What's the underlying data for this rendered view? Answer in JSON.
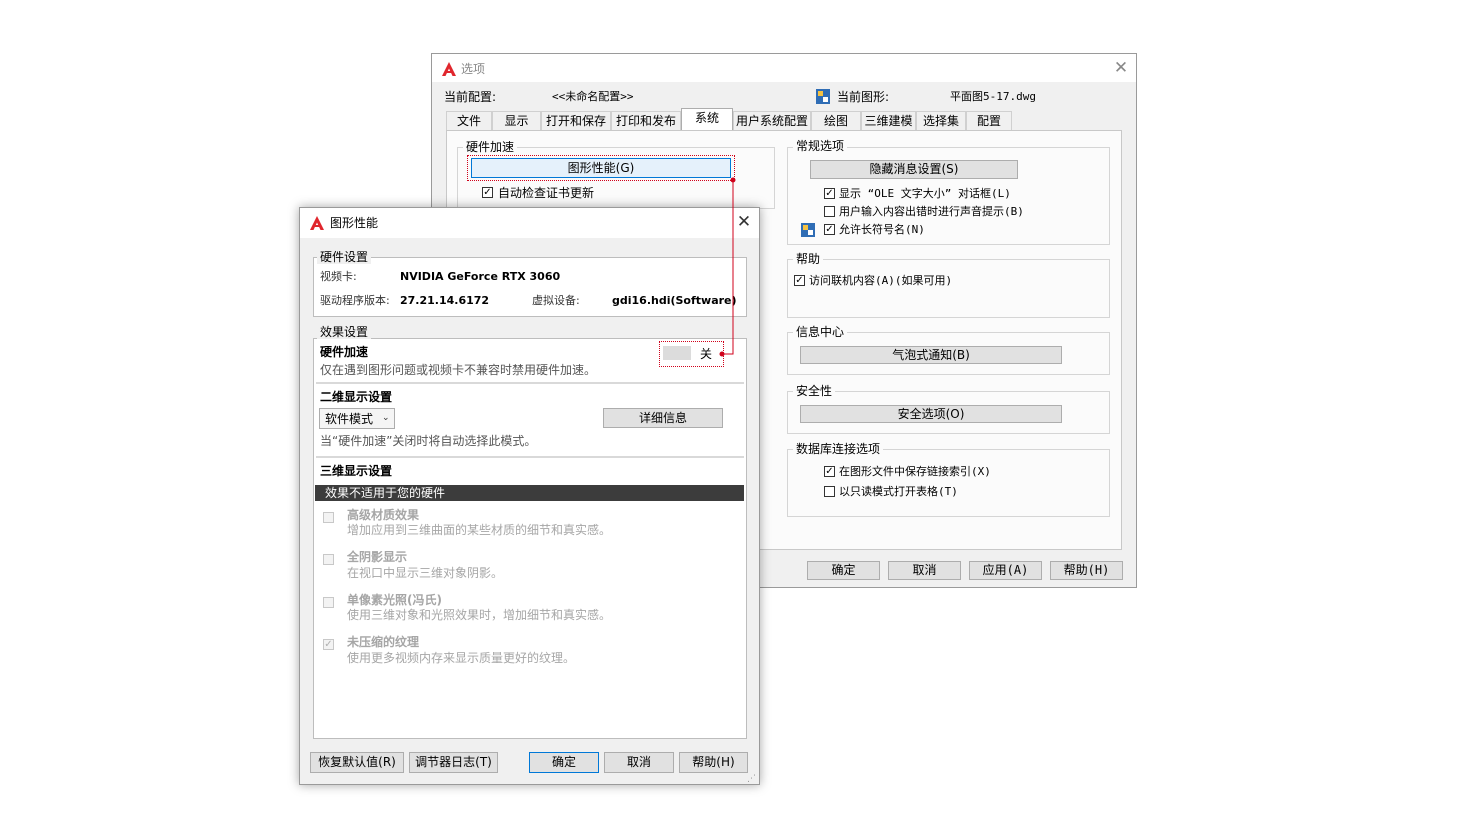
{
  "options": {
    "title": "选项",
    "current_profile_label": "当前配置:",
    "current_profile_value": "<<未命名配置>>",
    "current_drawing_label": "当前图形:",
    "current_drawing_value": "平面图5-17.dwg",
    "tabs": [
      "文件",
      "显示",
      "打开和保存",
      "打印和发布",
      "系统",
      "用户系统配置",
      "绘图",
      "三维建模",
      "选择集",
      "配置"
    ],
    "hardware_accel": {
      "title": "硬件加速",
      "graphics_perf_button": "图形性能(G)",
      "auto_check_cert": "自动检查证书更新"
    },
    "general": {
      "title": "常规选项",
      "hide_messages_button": "隐藏消息设置(S)",
      "show_ole": "显示 “OLE 文字大小” 对话框(L)",
      "beep": "用户输入内容出错时进行声音提示(B)",
      "long_names": "允许长符号名(N)"
    },
    "help": {
      "title": "帮助",
      "online_content": "访问联机内容(A)(如果可用)"
    },
    "info_center": {
      "title": "信息中心",
      "balloon_button": "气泡式通知(B)"
    },
    "security": {
      "title": "安全性",
      "security_button": "安全选项(O)"
    },
    "db": {
      "title": "数据库连接选项",
      "store_links": "在图形文件中保存链接索引(X)",
      "readonly_tables": "以只读模式打开表格(T)"
    },
    "buttons": {
      "ok": "确定",
      "cancel": "取消",
      "apply": "应用(A)",
      "help": "帮助(H)"
    }
  },
  "perf": {
    "title": "图形性能",
    "hardware": {
      "title": "硬件设置",
      "video_label": "视频卡:",
      "video_value": "NVIDIA GeForce RTX 3060",
      "driver_label": "驱动程序版本:",
      "driver_value": "27.21.14.6172",
      "virtual_label": "虚拟设备:",
      "virtual_value": "gdi16.hdi(Software)"
    },
    "effects": {
      "title": "效果设置",
      "hw_accel_title": "硬件加速",
      "hw_accel_desc": "仅在遇到图形问题或视频卡不兼容时禁用硬件加速。",
      "toggle_state": "关"
    },
    "display2d": {
      "title": "二维显示设置",
      "mode": "软件模式",
      "details_button": "详细信息",
      "note": "当“硬件加速”关闭时将自动选择此模式。"
    },
    "display3d": {
      "title": "三维显示设置",
      "banner": "效果不适用于您的硬件",
      "items": [
        {
          "name": "高级材质效果",
          "desc": "增加应用到三维曲面的某些材质的细节和真实感。",
          "checked": false
        },
        {
          "name": "全阴影显示",
          "desc": "在视口中显示三维对象阴影。",
          "checked": false
        },
        {
          "name": "单像素光照(冯氏)",
          "desc": "使用三维对象和光照效果时，增加细节和真实感。",
          "checked": false
        },
        {
          "name": "未压缩的纹理",
          "desc": "使用更多视频内存来显示质量更好的纹理。",
          "checked": true
        }
      ]
    },
    "buttons": {
      "restore": "恢复默认值(R)",
      "log": "调节器日志(T)",
      "ok": "确定",
      "cancel": "取消",
      "help": "帮助(H)"
    }
  },
  "colors": {
    "accent_red": "#d0021b",
    "banner_bg": "#3c3c3c",
    "logo_red": "#e0262d"
  }
}
